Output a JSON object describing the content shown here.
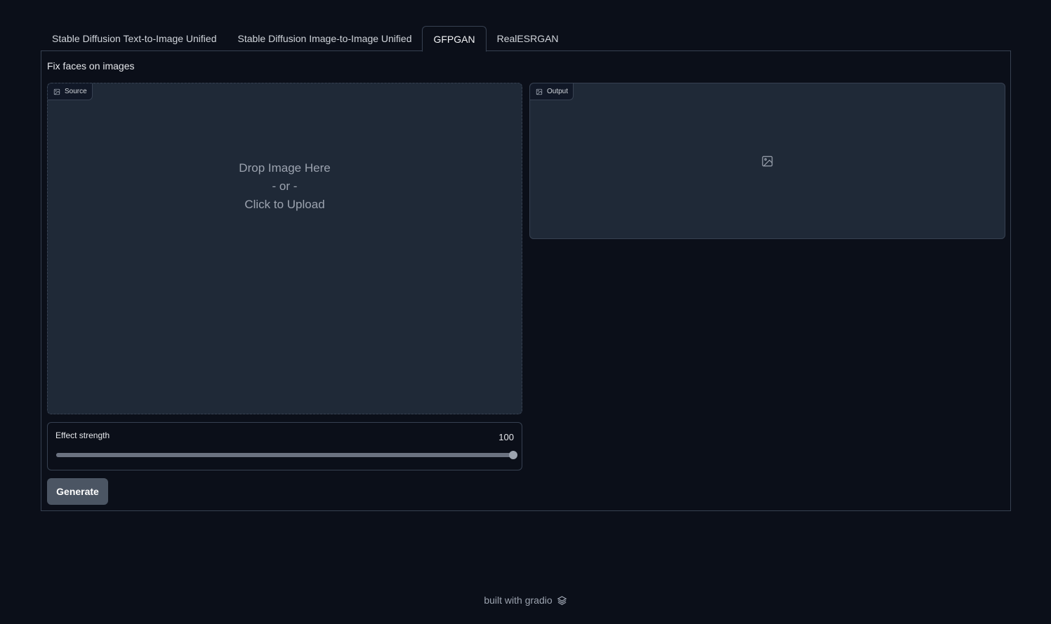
{
  "tabs": [
    {
      "label": "Stable Diffusion Text-to-Image Unified",
      "active": false
    },
    {
      "label": "Stable Diffusion Image-to-Image Unified",
      "active": false
    },
    {
      "label": "GFPGAN",
      "active": true
    },
    {
      "label": "RealESRGAN",
      "active": false
    }
  ],
  "panel": {
    "description": "Fix faces on images",
    "source": {
      "label": "Source",
      "icon": "image-icon",
      "upload_line1": "Drop Image Here",
      "upload_line2": "- or -",
      "upload_line3": "Click to Upload"
    },
    "output": {
      "label": "Output",
      "icon": "image-icon",
      "placeholder_icon": "image-placeholder-icon"
    },
    "slider": {
      "label": "Effect strength",
      "value": "100",
      "fraction": 1.0
    },
    "generate_label": "Generate"
  },
  "footer": {
    "text": "built with gradio",
    "icon": "gradio-logo-icon"
  },
  "colors": {
    "background": "#0b0f19",
    "panel_border": "#374151",
    "box_fill": "#1f2937",
    "button": "#4b5563"
  }
}
